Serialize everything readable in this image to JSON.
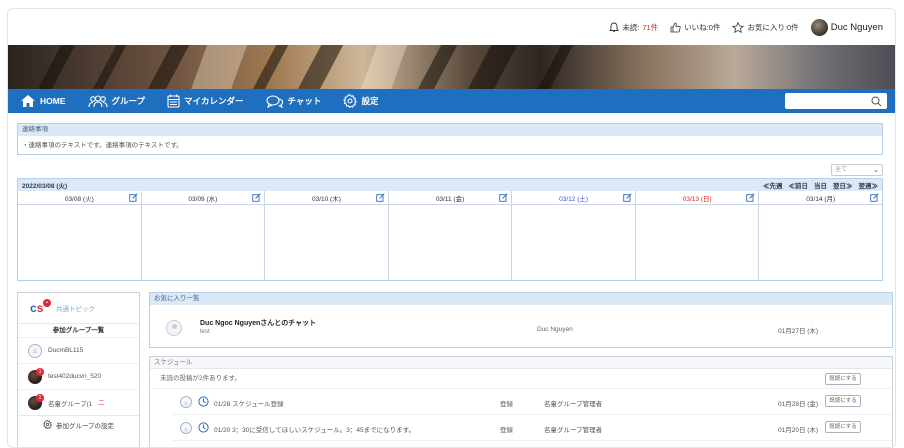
{
  "topbar": {
    "notifications_label": "未読:",
    "notifications_count": "71件",
    "likes_label": "いいね:0件",
    "favorites_label": "お気に入り:0件",
    "user_name": "Duc Nguyen"
  },
  "nav": {
    "items": [
      {
        "label": "HOME",
        "icon": "home-icon"
      },
      {
        "label": "グループ",
        "icon": "group-icon"
      },
      {
        "label": "マイカレンダー",
        "icon": "calendar-icon"
      },
      {
        "label": "チャット",
        "icon": "chat-icon"
      },
      {
        "label": "設定",
        "icon": "gear-icon"
      }
    ],
    "search_placeholder": ""
  },
  "notice": {
    "title": "連絡事項",
    "body": "・連絡事項のテキストです。連絡事項のテキストです。"
  },
  "select": {
    "value": "全て"
  },
  "calendar": {
    "date": "2022/03/08 (火)",
    "nav": [
      "≪先週",
      "≪前日",
      "当日",
      "翌日≫",
      "翌週≫"
    ],
    "days": [
      {
        "label": "03/08 (火)",
        "kind": "weekday"
      },
      {
        "label": "03/09 (水)",
        "kind": "weekday"
      },
      {
        "label": "03/10 (木)",
        "kind": "weekday"
      },
      {
        "label": "03/11 (金)",
        "kind": "weekday"
      },
      {
        "label": "03/12 (土)",
        "kind": "sat"
      },
      {
        "label": "03/13 (日)",
        "kind": "sun"
      },
      {
        "label": "03/14 (月)",
        "kind": "weekday"
      }
    ]
  },
  "sidebar": {
    "common_topic": "共通トピック",
    "groups_title": "参加グループ一覧",
    "groups": [
      {
        "name": "DucmBL115",
        "avatar": "light"
      },
      {
        "name": "test402ducvn_520",
        "avatar": "dark",
        "badge": "1"
      },
      {
        "name": "名童グループ(1",
        "avatar": "dark",
        "badge": "1",
        "flag": "二"
      }
    ],
    "settings_label": "参加グループの設定"
  },
  "favorites": {
    "title": "お気に入り一覧",
    "item": {
      "title": "Duc Ngoc Nguyenさんとのチャット",
      "subtitle": "test",
      "user": "Duc Nguyen",
      "date": "01月27日 (木)"
    }
  },
  "schedule": {
    "title": "スケジュール",
    "unread_text": "未読の投稿が2件あります。",
    "mark_read_label": "既読にする",
    "rows": [
      {
        "title": "01/28 スケジュール登録",
        "reg": "登録",
        "group": "名童グループ管理者",
        "date": "01月28日 (金)",
        "button": "既読にする"
      },
      {
        "title": "01/20 3：30に受信してほしいスケジュール。3：45までになります。",
        "reg": "登録",
        "group": "名童グループ管理者",
        "date": "01月20日 (木)",
        "button": "既読にする"
      }
    ]
  },
  "colors": {
    "nav_blue": "#1f6fc0",
    "panel_header": "#dbe8f6",
    "saturday": "#3a4fd1",
    "sunday": "#dd2222",
    "badge_red": "#e0283a"
  }
}
